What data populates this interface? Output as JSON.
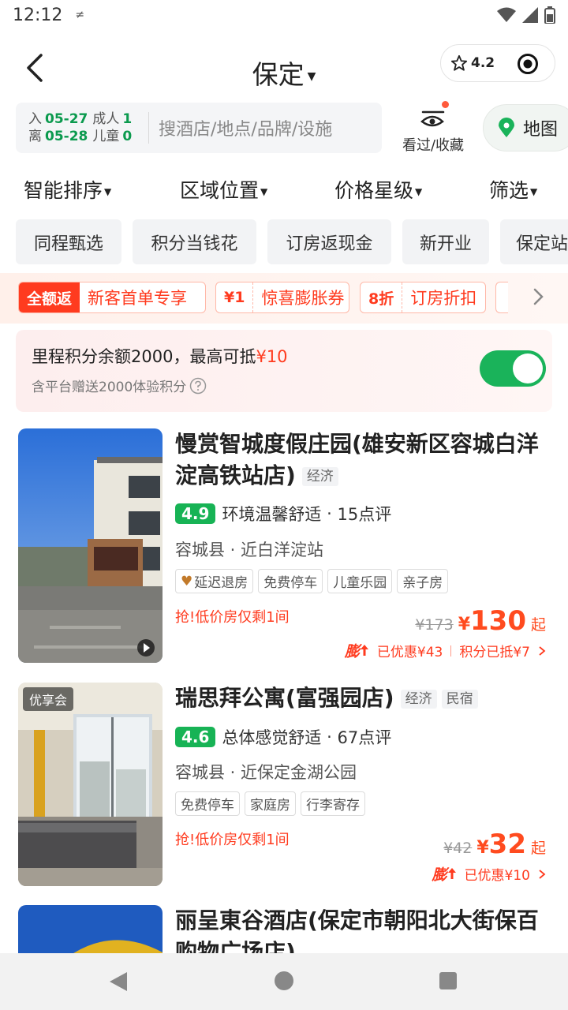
{
  "status_bar": {
    "time": "12:12",
    "icon_glyph": "≠"
  },
  "header": {
    "city": "保定",
    "rating": "4.2"
  },
  "search": {
    "checkin_label": "入",
    "checkin_date": "05-27",
    "checkout_label": "离",
    "checkout_date": "05-28",
    "adult_label": "成人",
    "adult_count": "1",
    "child_label": "儿童",
    "child_count": "0",
    "placeholder": "搜酒店/地点/品牌/设施"
  },
  "favorites": {
    "label": "看过/收藏"
  },
  "map": {
    "label": "地图"
  },
  "sort_tabs": [
    "智能排序",
    "区域位置",
    "价格星级",
    "筛选"
  ],
  "chips": [
    "同程甄选",
    "积分当钱花",
    "订房返现金",
    "新开业",
    "保定站"
  ],
  "promos": [
    {
      "tag": "全额返",
      "text": "新客首单专享"
    },
    {
      "tag": "¥1",
      "text": "惊喜膨胀券"
    },
    {
      "tag": "8折",
      "text": "订房折扣"
    }
  ],
  "mileage": {
    "main": "里程积分余额2000，最高可抵",
    "amount": "¥10",
    "sub": "含平台赠送2000体验积分",
    "toggle_on": true
  },
  "hotels": [
    {
      "name": "慢赏智城度假庄园(雄安新区容城白洋淀高铁站店)",
      "tags": [
        "经济"
      ],
      "score": "4.9",
      "comment": "环境温馨舒适",
      "reviews": "15点评",
      "location": "容城县 · 近白洋淀站",
      "facilities": [
        "延迟退房",
        "免费停车",
        "儿童乐园",
        "亲子房"
      ],
      "urgent": "抢!低价房仅剩1间",
      "orig_price": "¥173",
      "price": "130",
      "currency": "¥",
      "price_suffix": "起",
      "peng": "膨",
      "discount": "已优惠¥43",
      "points": "积分已抵¥7"
    },
    {
      "badge": "优享会",
      "name": "瑞思拜公寓(富强园店)",
      "tags": [
        "经济",
        "民宿"
      ],
      "score": "4.6",
      "comment": "总体感觉舒适",
      "reviews": "67点评",
      "location": "容城县 · 近保定金湖公园",
      "facilities": [
        "免费停车",
        "家庭房",
        "行李寄存"
      ],
      "urgent": "抢!低价房仅剩1间",
      "orig_price": "¥42",
      "price": "32",
      "currency": "¥",
      "price_suffix": "起",
      "peng": "膨",
      "discount": "已优惠¥10"
    },
    {
      "name": "丽呈東谷酒店(保定市朝阳北大街保百购物广场店)"
    }
  ]
}
